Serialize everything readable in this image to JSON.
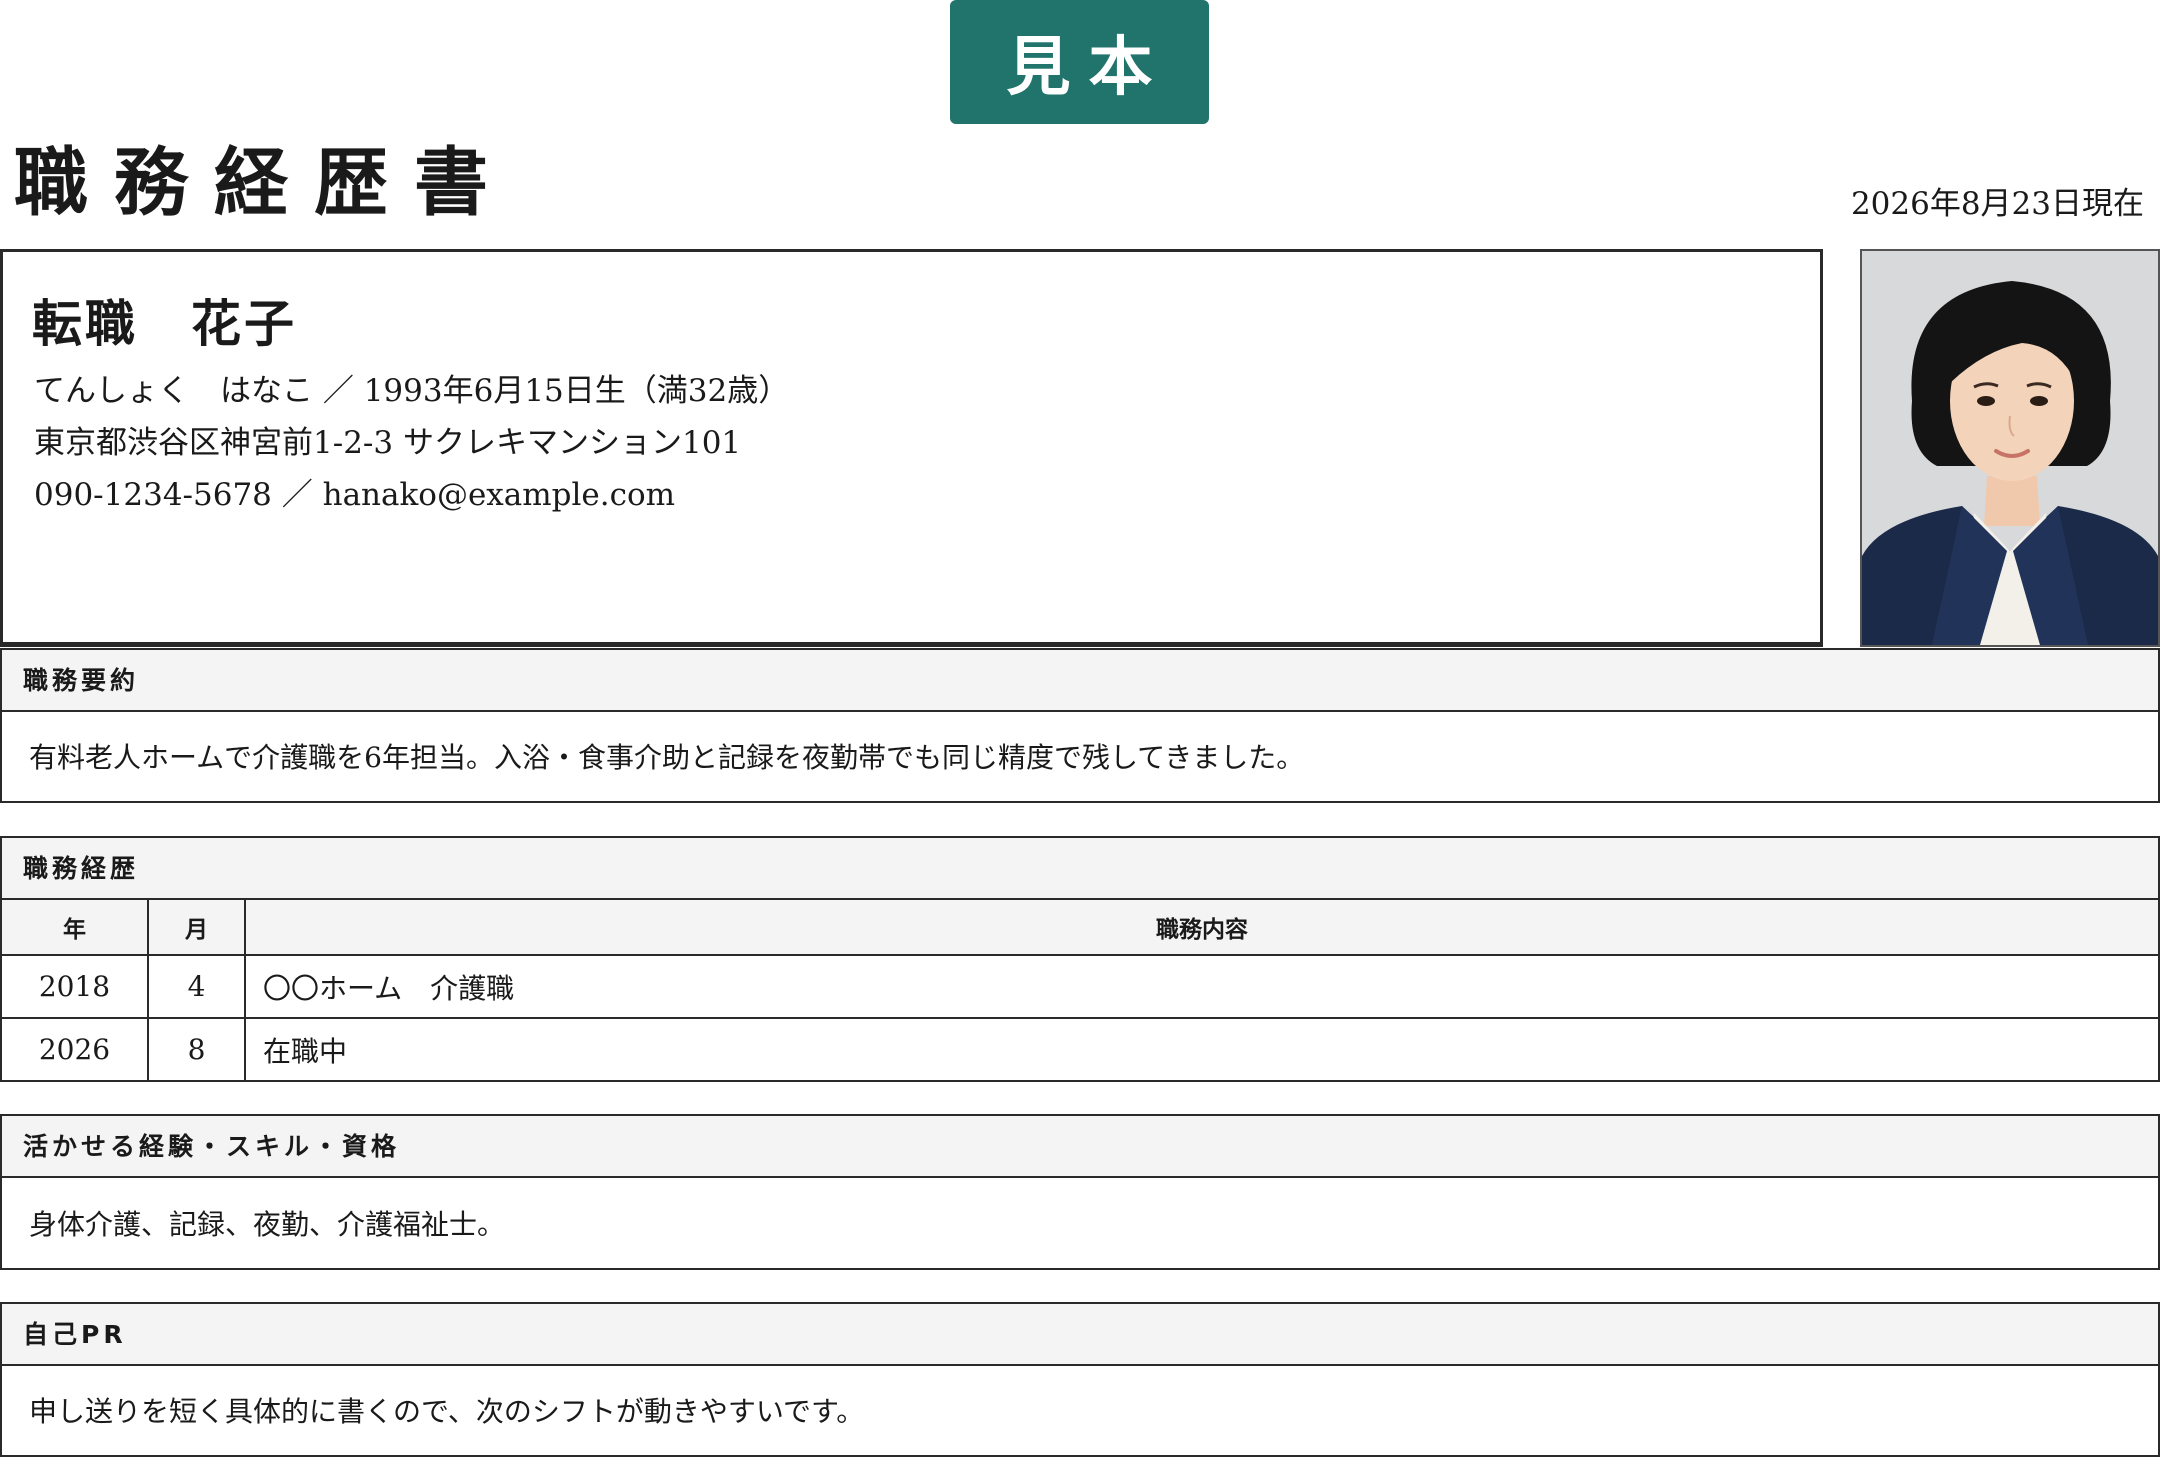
{
  "header": {
    "badge": "見本",
    "title": "職務経歴書",
    "as_of_date": "2026年8月23日現在"
  },
  "profile": {
    "name": "転職　花子",
    "furigana_birth": "てんしょく　はなこ ／ 1993年6月15日生（満32歳）",
    "address": "東京都渋谷区神宮前1-2-3 サクレキマンション101",
    "contact": "090-1234-5678 ／ hanako@example.com"
  },
  "summary": {
    "heading": "職務要約",
    "text": "有料老人ホームで介護職を6年担当。入浴・食事介助と記録を夜勤帯でも同じ精度で残してきました。"
  },
  "career": {
    "heading": "職務経歴",
    "columns": [
      "年",
      "月",
      "職務内容"
    ],
    "rows": [
      {
        "year": "2018",
        "month": "4",
        "content": "〇〇ホーム　介護職"
      },
      {
        "year": "2026",
        "month": "8",
        "content": "在職中"
      }
    ]
  },
  "skills": {
    "heading": "活かせる経験・スキル・資格",
    "text": "身体介護、記録、夜勤、介護福祉士。"
  },
  "pr": {
    "heading": "自己PR",
    "text": "申し送りを短く具体的に書くので、次のシフトが動きやすいです。"
  },
  "colors": {
    "badge_bg": "#20746b",
    "border": "#2a2a2a",
    "header_bg": "#f4f4f4"
  }
}
